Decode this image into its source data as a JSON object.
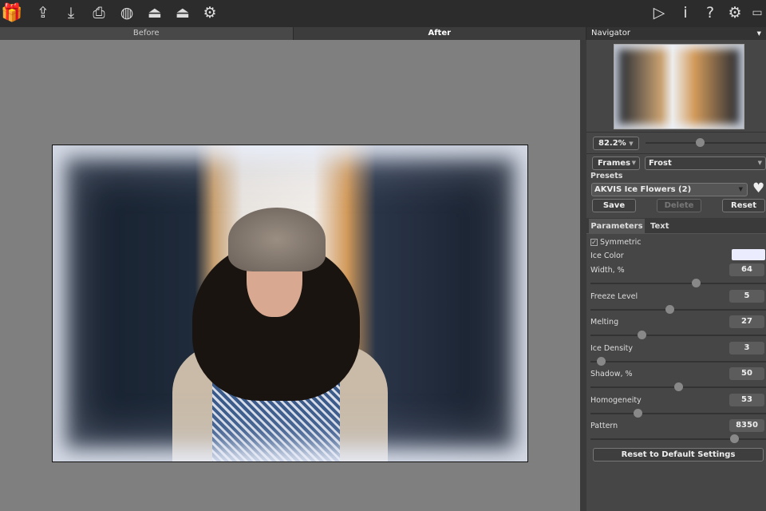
{
  "toolbar": {
    "left_icons": [
      "gift-icon",
      "open-image-icon",
      "save-icon",
      "print-icon",
      "share-icon",
      "batch-icon",
      "batch-settings-icon",
      "settings-gears-icon"
    ],
    "right_icons": [
      "run-icon",
      "info-icon",
      "help-icon",
      "preferences-icon",
      "tooltip-icon"
    ]
  },
  "view_tabs": {
    "before": "Before",
    "after": "After"
  },
  "navigator": {
    "title": "Navigator",
    "zoom": "82.2%",
    "zoom_level": 0.45
  },
  "effect": {
    "category": "Frames",
    "style": "Frost"
  },
  "presets": {
    "label": "Presets",
    "selected": "AKVIS Ice Flowers (2)",
    "save": "Save",
    "delete": "Delete",
    "reset": "Reset"
  },
  "panel_tabs": {
    "parameters": "Parameters",
    "text": "Text"
  },
  "params": {
    "symmetric": "Symmetric",
    "symmetric_checked": true,
    "ice_color_label": "Ice Color",
    "ice_color": "#ececff",
    "sliders": [
      {
        "label": "Width, %",
        "value": "64",
        "level": 0.6
      },
      {
        "label": "Freeze Level",
        "value": "5",
        "level": 0.45
      },
      {
        "label": "Melting",
        "value": "27",
        "level": 0.29
      },
      {
        "label": "Ice Density",
        "value": "3",
        "level": 0.06
      },
      {
        "label": "Shadow, %",
        "value": "50",
        "level": 0.5
      },
      {
        "label": "Homogeneity",
        "value": "53",
        "level": 0.27
      },
      {
        "label": "Pattern",
        "value": "8350",
        "level": 0.82
      }
    ],
    "reset_default": "Reset to Default Settings"
  }
}
